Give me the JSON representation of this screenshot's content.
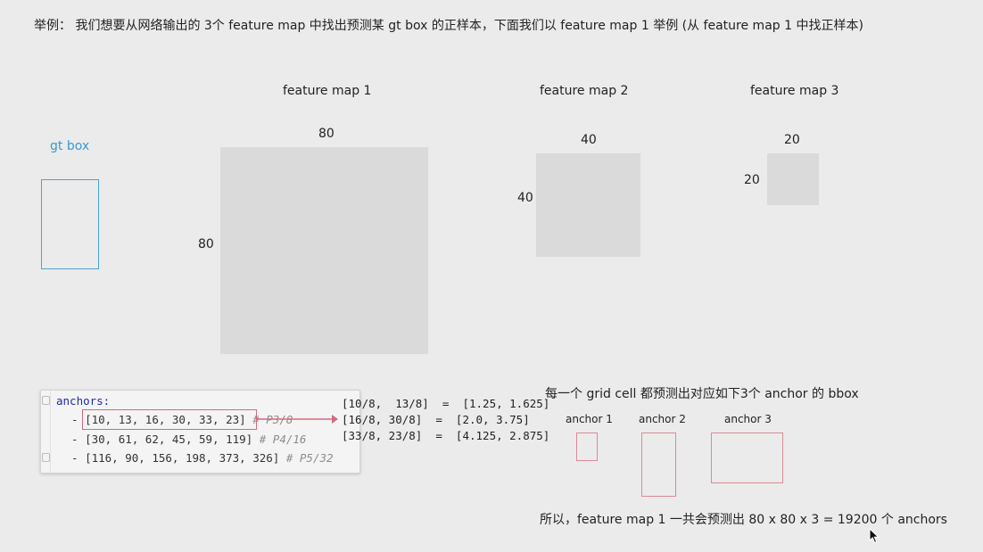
{
  "heading": "举例： 我们想要从网络输出的 3个 feature map 中找出预测某 gt box 的正样本，下面我们以 feature map 1 举例 (从 feature map 1 中找正样本)",
  "gt_box": {
    "label": "gt box"
  },
  "feature_maps": [
    {
      "title": "feature map 1",
      "width_label": "80",
      "height_label": "80"
    },
    {
      "title": "feature map 2",
      "width_label": "40",
      "height_label": "40"
    },
    {
      "title": "feature map 3",
      "width_label": "20",
      "height_label": "20"
    }
  ],
  "code": {
    "key": "anchors:",
    "lines": [
      {
        "dash": "- ",
        "values": "[10, 13, 16, 30, 33, 23]",
        "comment": "# P3/8"
      },
      {
        "dash": "- ",
        "values": "[30, 61, 62, 45, 59, 119]",
        "comment": "# P4/16"
      },
      {
        "dash": "- ",
        "values": "[116, 90, 156, 198, 373, 326]",
        "comment": "# P5/32"
      }
    ]
  },
  "calculations": [
    "[10/8,  13/8]  =  [1.25, 1.625]",
    "[16/8, 30/8]  =  [2.0, 3.75]",
    "[33/8, 23/8]  =  [4.125, 2.875]"
  ],
  "anchors_section": {
    "title": "每一个 grid cell 都预测出对应如下3个 anchor 的 bbox",
    "anchors": [
      {
        "label": "anchor 1"
      },
      {
        "label": "anchor 2"
      },
      {
        "label": "anchor 3"
      }
    ]
  },
  "summary": "所以，feature map 1 一共会预测出 80 x 80 x 3 = 19200 个 anchors",
  "colors": {
    "gt_box": "#4aa3d6",
    "highlight": "#d46a7e",
    "feature_map_fill": "#dadada",
    "anchor_border": "#d98a98"
  }
}
